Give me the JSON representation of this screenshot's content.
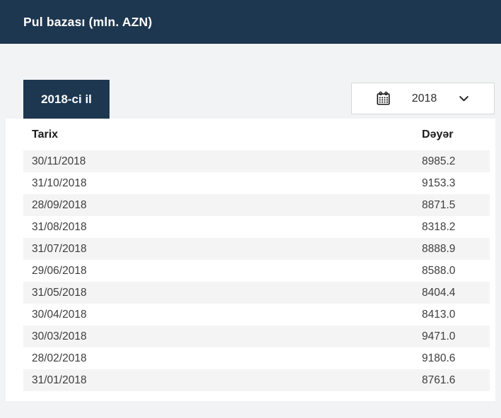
{
  "header": {
    "title": "Pul bazası (mln. AZN)"
  },
  "toolbar": {
    "year_badge_label": "2018-ci il",
    "dropdown": {
      "selected_value": "2018",
      "icons": [
        "calendar-icon",
        "chevron-down-icon"
      ]
    }
  },
  "table": {
    "columns": [
      "Tarix",
      "Dəyər"
    ],
    "rows": [
      {
        "date": "30/11/2018",
        "value": "8985.2"
      },
      {
        "date": "31/10/2018",
        "value": "9153.3"
      },
      {
        "date": "28/09/2018",
        "value": "8871.5"
      },
      {
        "date": "31/08/2018",
        "value": "8318.2"
      },
      {
        "date": "31/07/2018",
        "value": "8888.9"
      },
      {
        "date": "29/06/2018",
        "value": "8588.0"
      },
      {
        "date": "31/05/2018",
        "value": "8404.4"
      },
      {
        "date": "30/04/2018",
        "value": "8413.0"
      },
      {
        "date": "30/03/2018",
        "value": "9471.0"
      },
      {
        "date": "28/02/2018",
        "value": "9180.6"
      },
      {
        "date": "31/01/2018",
        "value": "8761.6"
      }
    ]
  },
  "colors": {
    "navy": "#1e3750",
    "page_background": "#f2f3f4",
    "panel_background": "#ffffff",
    "row_stripe": "#f4f4f5",
    "dropdown_border": "#d8d8d8"
  }
}
